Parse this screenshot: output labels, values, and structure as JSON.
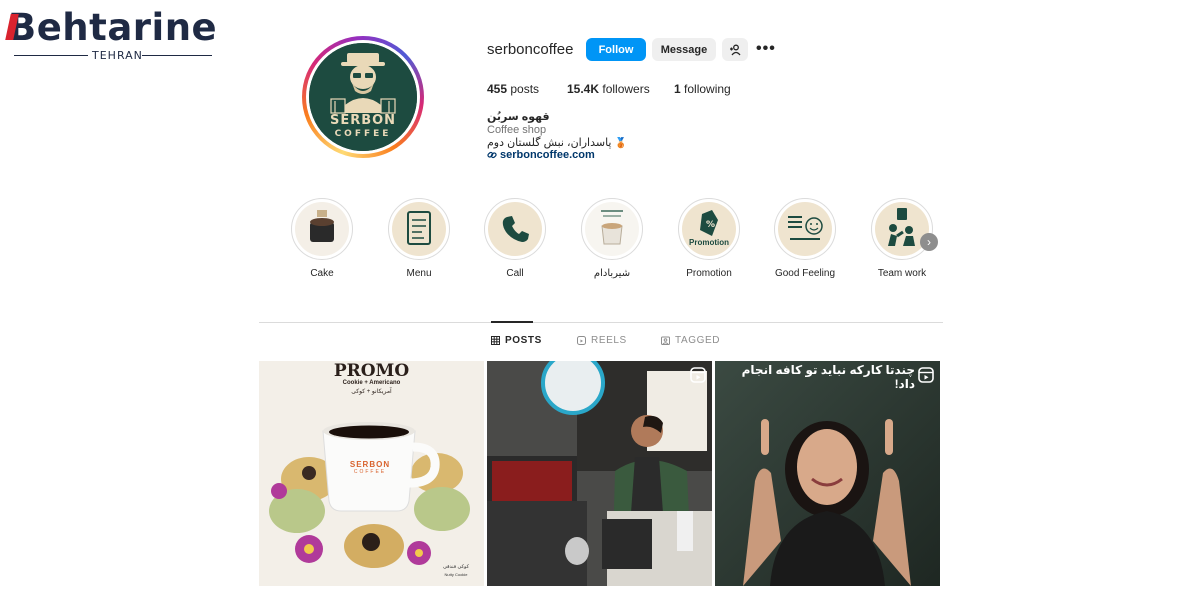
{
  "brand": {
    "name": "Behtarine",
    "subtitle": "TEHRAN"
  },
  "profile": {
    "username": "serboncoffee",
    "follow_label": "Follow",
    "message_label": "Message",
    "posts_count": "455",
    "posts_label": "posts",
    "followers_count": "15.4K",
    "followers_label": "followers",
    "following_count": "1",
    "following_label": "following",
    "full_name": "قهوه سربُن",
    "category": "Coffee shop",
    "bio": "پاسداران، نبش گلستان دوم",
    "website": "serboncoffee.com",
    "avatar_text_line1": "SERBON",
    "avatar_text_line2": "COFFEE"
  },
  "highlights": [
    {
      "label": "Cake"
    },
    {
      "label": "Menu"
    },
    {
      "label": "Call"
    },
    {
      "label": "شیربادام"
    },
    {
      "label": "Promotion"
    },
    {
      "label": "Good Feeling"
    },
    {
      "label": "Team work"
    }
  ],
  "tabs": {
    "posts": "POSTS",
    "reels": "REELS",
    "tagged": "TAGGED"
  },
  "posts": [
    {
      "title": "PROMO",
      "subtitle": "Cookie + Americano",
      "subtitle_fa": "آمریکانو + کوکی",
      "cup_text1": "SERBON",
      "cup_text2": "COFFEE",
      "corner_text": "کوکی فندقی",
      "corner_text2": "Nutty Cookie"
    },
    {
      "type": "reel"
    },
    {
      "type": "reel",
      "caption": "چندتا کارکه نباید تو کافه انجام داد!"
    }
  ],
  "colors": {
    "accent": "#0095f6",
    "brand_green": "#1d4b40",
    "highlight_bg": "#efe4cf"
  }
}
